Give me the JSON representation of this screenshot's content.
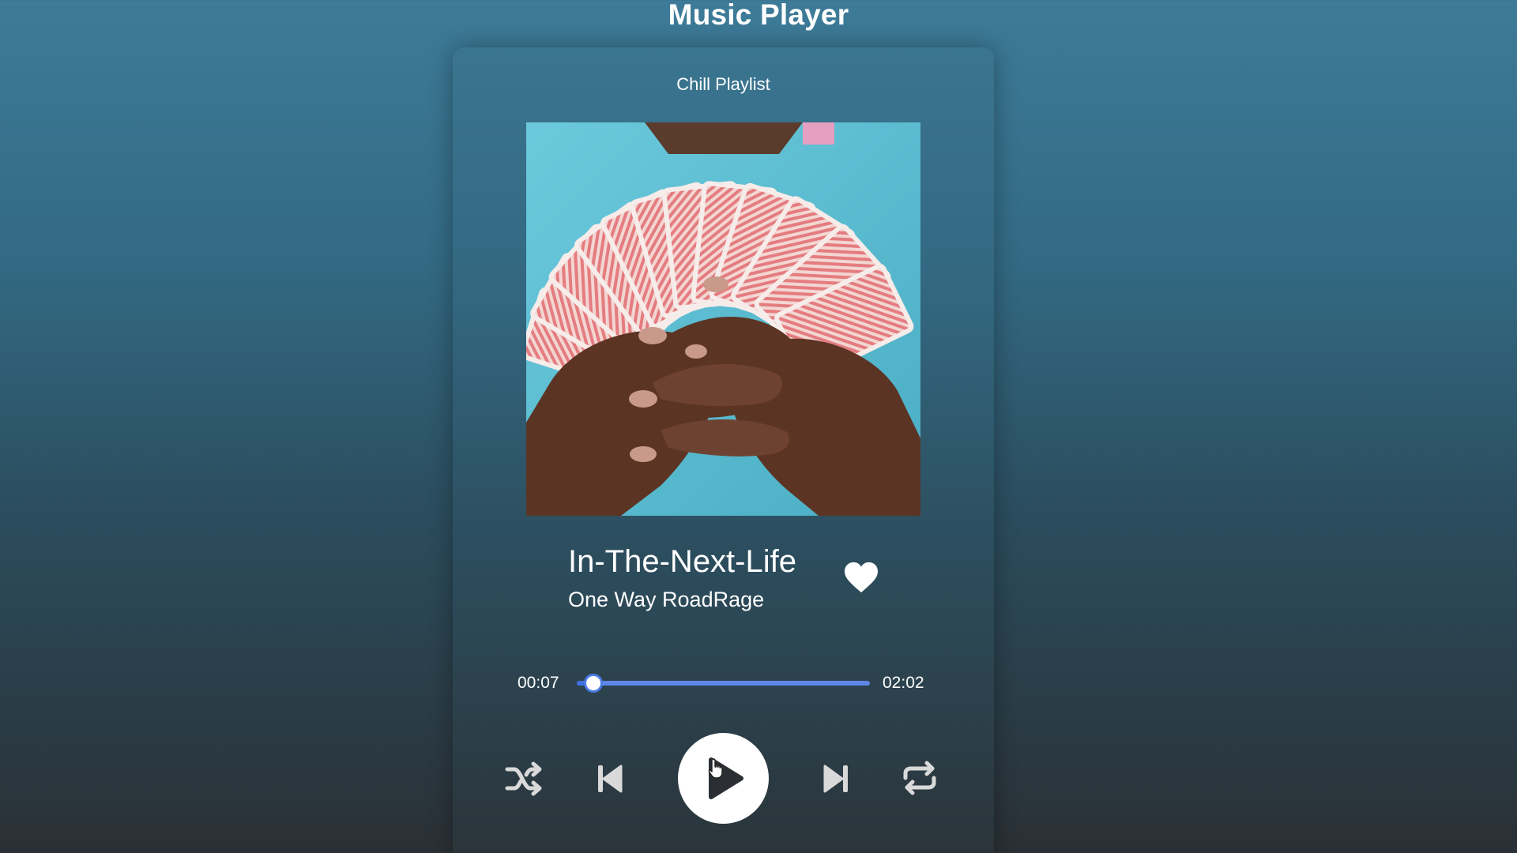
{
  "app": {
    "title": "Music Player"
  },
  "player": {
    "playlist_name": "Chill Playlist",
    "album_art": {
      "subject": "hands holding a fanned deck of red-backed playing cards on a light blue background"
    },
    "track": {
      "title": "In-The-Next-Life",
      "artist": "One Way RoadRage",
      "liked": true
    },
    "progress": {
      "current_time": "00:07",
      "total_time": "02:02",
      "fraction": 0.057
    },
    "controls": {
      "shuffle_icon": "shuffle-icon",
      "previous_icon": "skip-previous-icon",
      "play_icon": "play-icon",
      "next_icon": "skip-next-icon",
      "repeat_icon": "repeat-icon",
      "is_playing": false
    }
  },
  "colors": {
    "accent": "#4d7ce6",
    "background_top": "#3d7b98",
    "background_bottom": "#2a3035",
    "text": "#ffffff"
  }
}
